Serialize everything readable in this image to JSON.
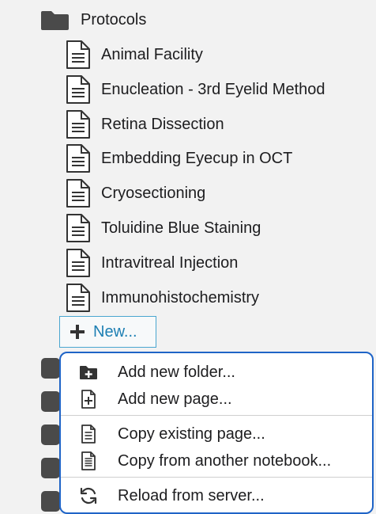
{
  "tree": {
    "folder": {
      "label": "Protocols",
      "icon": "folder-icon"
    },
    "pages": [
      {
        "label": "Animal Facility",
        "icon": "document-icon"
      },
      {
        "label": "Enucleation - 3rd Eyelid Method",
        "icon": "document-icon"
      },
      {
        "label": "Retina Dissection",
        "icon": "document-icon"
      },
      {
        "label": "Embedding Eyecup in OCT",
        "icon": "document-icon"
      },
      {
        "label": "Cryosectioning",
        "icon": "document-icon"
      },
      {
        "label": "Toluidine Blue Staining",
        "icon": "document-icon"
      },
      {
        "label": "Intravitreal Injection",
        "icon": "document-icon"
      },
      {
        "label": "Immunohistochemistry",
        "icon": "document-icon"
      }
    ],
    "new_button": {
      "label": "New...",
      "icon": "plus-icon"
    }
  },
  "menu": {
    "items": [
      {
        "label": "Add new folder...",
        "icon": "folder-plus-icon"
      },
      {
        "label": "Add new page...",
        "icon": "page-plus-icon"
      },
      {
        "label": "Copy existing page...",
        "icon": "copy-page-icon"
      },
      {
        "label": "Copy from another notebook...",
        "icon": "copy-notebook-icon"
      },
      {
        "label": "Reload from server...",
        "icon": "reload-icon"
      }
    ]
  },
  "colors": {
    "background": "#f2f2f2",
    "accent_link": "#1d7fb3",
    "menu_border": "#1f64c7",
    "icon_dark": "#333333"
  }
}
